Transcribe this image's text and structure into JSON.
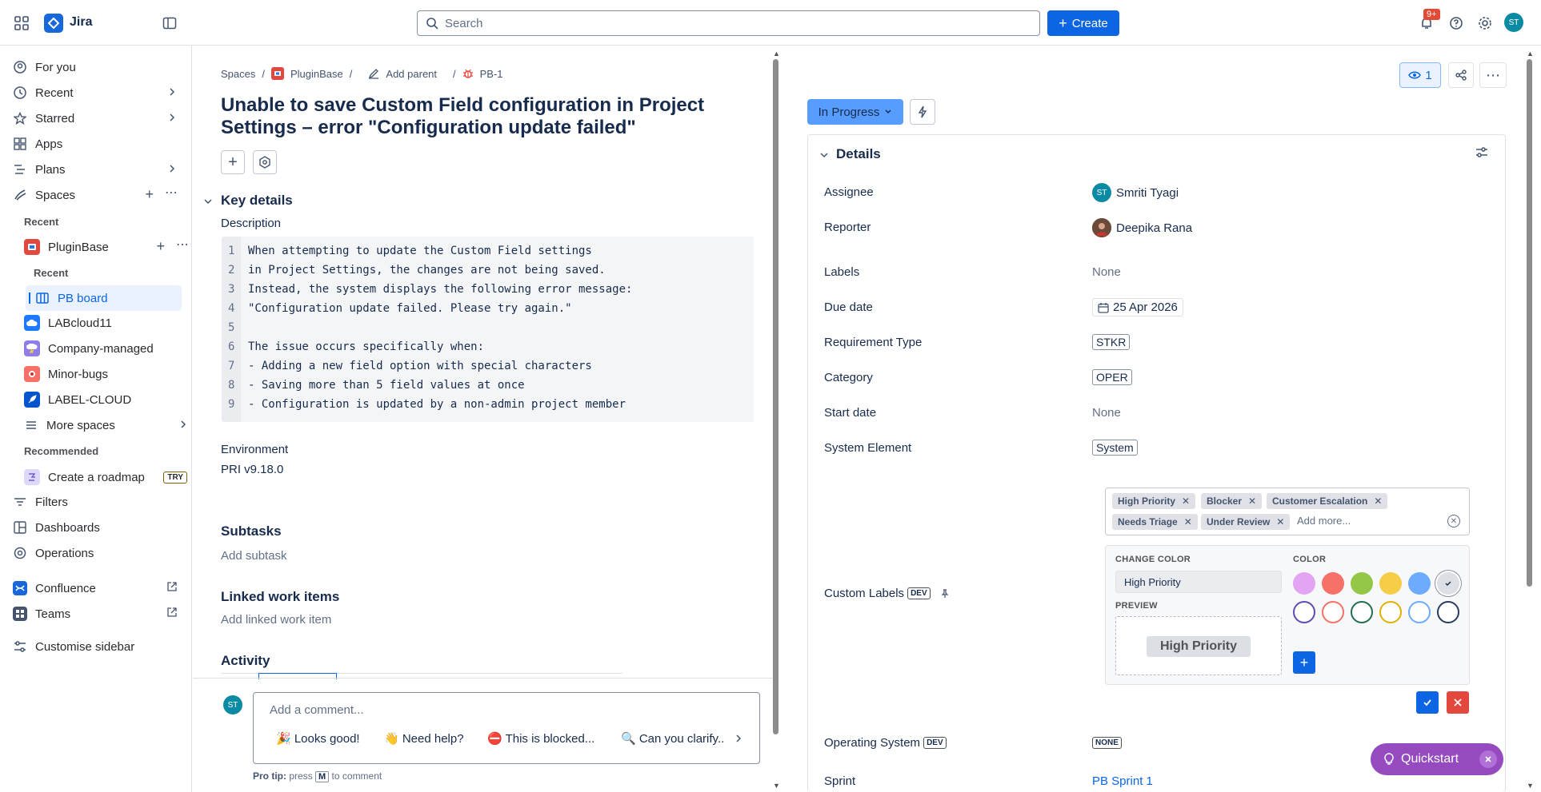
{
  "topbar": {
    "brand": "Jira",
    "search_placeholder": "Search",
    "create_label": "Create",
    "notif_count": "9+",
    "avatar_initials": "ST"
  },
  "sidebar": {
    "items": {
      "for_you": "For you",
      "recent": "Recent",
      "starred": "Starred",
      "apps": "Apps",
      "plans": "Plans",
      "spaces": "Spaces",
      "recent_section": "Recent",
      "pluginbase": "PluginBase",
      "pluginbase_recent": "Recent",
      "pb_board": "PB board",
      "labcloud": "LABcloud11",
      "company": "Company-managed",
      "minor": "Minor-bugs",
      "labelcloud": "LABEL-CLOUD",
      "more_spaces": "More spaces",
      "recommended": "Recommended",
      "roadmap": "Create a roadmap",
      "try": "TRY",
      "filters": "Filters",
      "dashboards": "Dashboards",
      "operations": "Operations",
      "confluence": "Confluence",
      "teams": "Teams",
      "customise": "Customise sidebar"
    }
  },
  "issue": {
    "breadcrumb": {
      "spaces": "Spaces",
      "project": "PluginBase",
      "add_parent": "Add parent",
      "key": "PB-1"
    },
    "title": "Unable to save Custom Field configuration in Project Settings – error \"Configuration update failed\"",
    "key_details": "Key details",
    "description_label": "Description",
    "description_lines": [
      "When attempting to update the Custom Field settings",
      "in Project Settings, the changes are not being saved.",
      "Instead, the system displays the following error message:",
      "\"Configuration update failed. Please try again.\"",
      "",
      "The issue occurs specifically when:",
      "- Adding a new field option with special characters",
      "- Saving more than 5 field values at once",
      "- Configuration is updated by a non-admin project member"
    ],
    "line_numbers": [
      "1",
      "2",
      "3",
      "4",
      "5",
      "6",
      "7",
      "8",
      "9"
    ],
    "environment_label": "Environment",
    "environment_value": "PRI v9.18.0",
    "subtasks": "Subtasks",
    "add_subtask": "Add subtask",
    "linked": "Linked work items",
    "add_linked": "Add linked work item",
    "activity": "Activity",
    "comment_avatar": "ST",
    "comment_placeholder": "Add a comment...",
    "chips": [
      "🎉 Looks good!",
      "👋 Need help?",
      "⛔ This is blocked...",
      "🔍 Can you clarify.."
    ],
    "pro_tip_a": "Pro tip:",
    "pro_tip_b": "press",
    "pro_tip_key": "M",
    "pro_tip_c": "to comment"
  },
  "right": {
    "watch_count": "1",
    "status": "In Progress",
    "details_title": "Details",
    "fields": {
      "assignee_label": "Assignee",
      "assignee_initials": "ST",
      "assignee": "Smriti Tyagi",
      "reporter_label": "Reporter",
      "reporter": "Deepika Rana",
      "labels_label": "Labels",
      "labels": "None",
      "due_label": "Due date",
      "due": "25 Apr 2026",
      "req_label": "Requirement Type",
      "req": "STKR",
      "cat_label": "Category",
      "cat": "OPER",
      "start_label": "Start date",
      "start": "None",
      "sys_label": "System Element",
      "sys": "System",
      "custom_label": "Custom Labels",
      "dev": "DEV",
      "os_label": "Operating System",
      "os": "NONE",
      "sprint_label": "Sprint",
      "sprint": "PB Sprint 1"
    },
    "custom_labels": {
      "chips": [
        "High Priority",
        "Blocker",
        "Customer Escalation",
        "Needs Triage",
        "Under Review"
      ],
      "add_more": "Add more...",
      "change_color": "CHANGE COLOR",
      "color": "COLOR",
      "name_value": "High Priority",
      "preview": "PREVIEW",
      "preview_chip": "High Priority",
      "solid_colors": [
        "#e2a4f3",
        "#f87168",
        "#94c748",
        "#f5cd47",
        "#6cabff",
        "#dcdfe4"
      ],
      "outline_colors": [
        "#5e4db2",
        "#f87168",
        "#216e4e",
        "#e2b203",
        "#6cabff",
        "#2c3e5d"
      ]
    },
    "quickstart": "Quickstart"
  },
  "colors": {
    "brand_blue": "#0c66e4",
    "status_blue": "#579dff",
    "quickstart_purple": "#964ac0"
  }
}
